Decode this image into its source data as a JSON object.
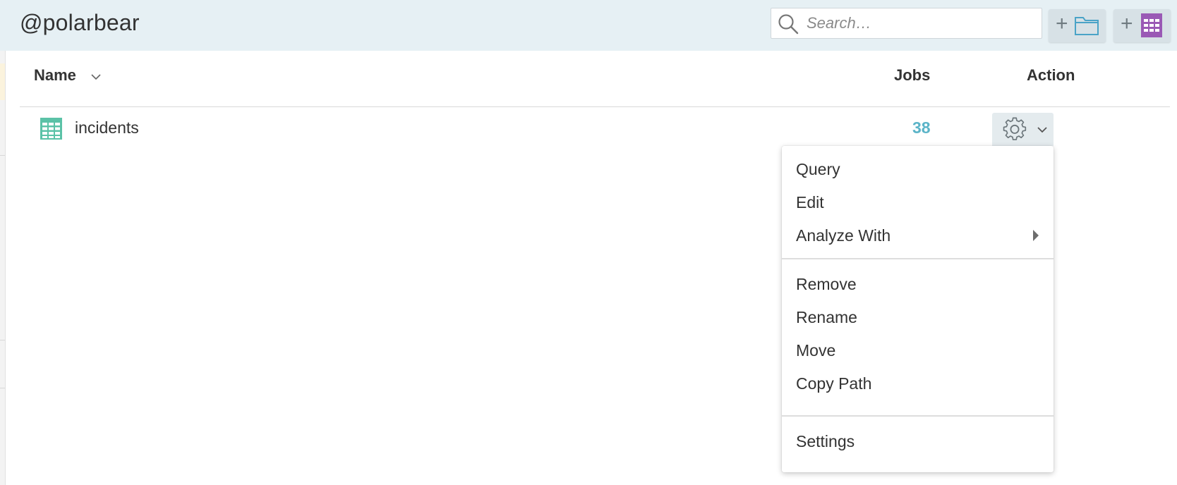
{
  "header": {
    "path_title": "@polarbear",
    "search": {
      "placeholder": "Search…",
      "value": ""
    },
    "new_folder_button": {
      "label": "+",
      "icon": "folder-icon",
      "color": "#4aa3c7"
    },
    "new_dataset_button": {
      "label": "+",
      "icon": "dataset-grid-icon",
      "color": "#9a59b5"
    }
  },
  "table": {
    "columns": {
      "name": "Name",
      "jobs": "Jobs",
      "action": "Action"
    },
    "sort_icon": "chevron-down-icon",
    "rows": [
      {
        "name": "incidents",
        "jobs": "38",
        "icon": "table-grid-icon",
        "icon_color": "#5bc2a7"
      }
    ]
  },
  "action_menu": {
    "trigger_icon": "gear-icon",
    "groups": [
      [
        {
          "label": "Query"
        },
        {
          "label": "Edit"
        },
        {
          "label": "Analyze With",
          "submenu": true
        }
      ],
      [
        {
          "label": "Remove"
        },
        {
          "label": "Rename"
        },
        {
          "label": "Move"
        },
        {
          "label": "Copy Path"
        }
      ],
      [
        {
          "label": "Settings"
        }
      ]
    ]
  },
  "colors": {
    "header_bg": "#e6f0f4",
    "accent": "#5bb4c8",
    "button_bg": "#d7e1e6"
  }
}
